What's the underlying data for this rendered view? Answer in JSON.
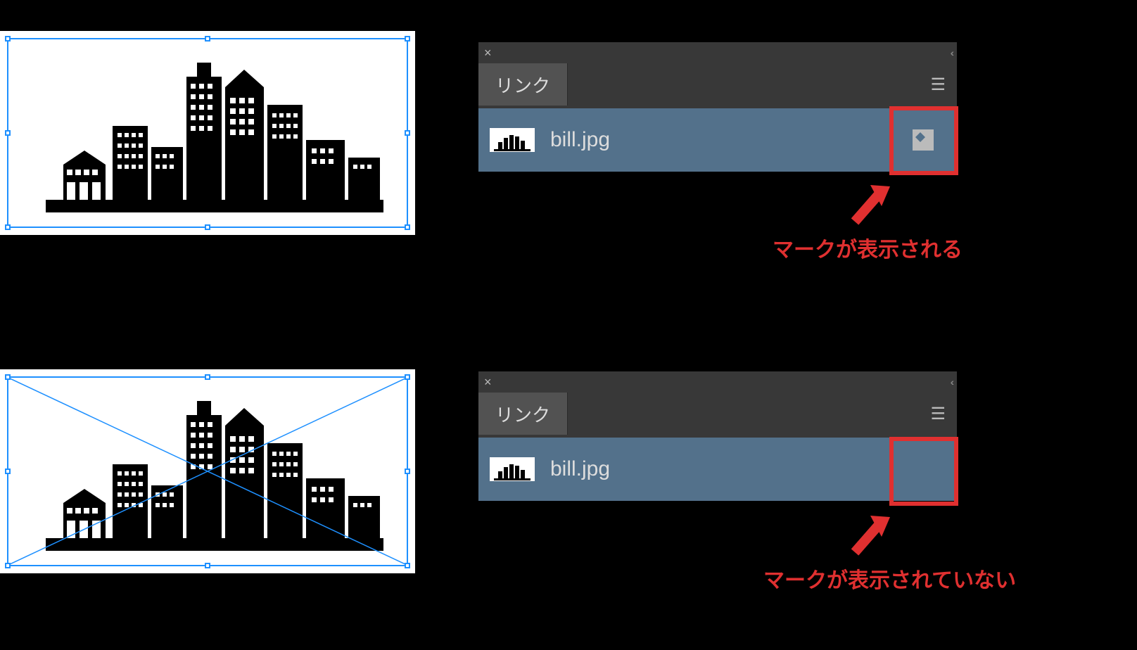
{
  "panel": {
    "tab_label": "リンク",
    "filename": "bill.jpg"
  },
  "annotations": {
    "mark_shown": "マークが表示される",
    "mark_not_shown": "マークが表示されていない"
  },
  "colors": {
    "highlight": "#e03030",
    "selection": "#1e90ff",
    "panel_bg": "#383838",
    "row_bg": "#53718b"
  }
}
